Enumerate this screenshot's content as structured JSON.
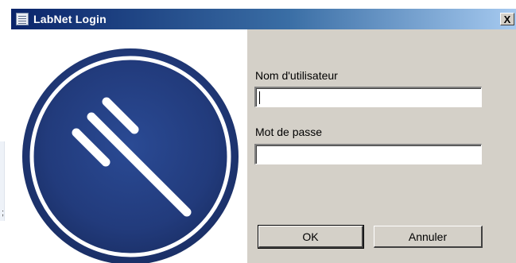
{
  "window": {
    "title": "LabNet Login",
    "close_label": "X"
  },
  "form": {
    "username_label": "Nom d'utilisateur",
    "username_value": "",
    "password_label": "Mot de passe",
    "password_value": ""
  },
  "buttons": {
    "ok_label": "OK",
    "cancel_label": "Annuler"
  },
  "background": {
    "glyph": ";"
  },
  "colors": {
    "titlebar_start": "#0a246a",
    "titlebar_end": "#a6caf0",
    "dialog_bg": "#d4d0c8",
    "logo_blue": "#233c7e"
  },
  "icons": {
    "title": "document-list-icon",
    "logo": "labnet-logo-icon",
    "close": "close-icon"
  }
}
